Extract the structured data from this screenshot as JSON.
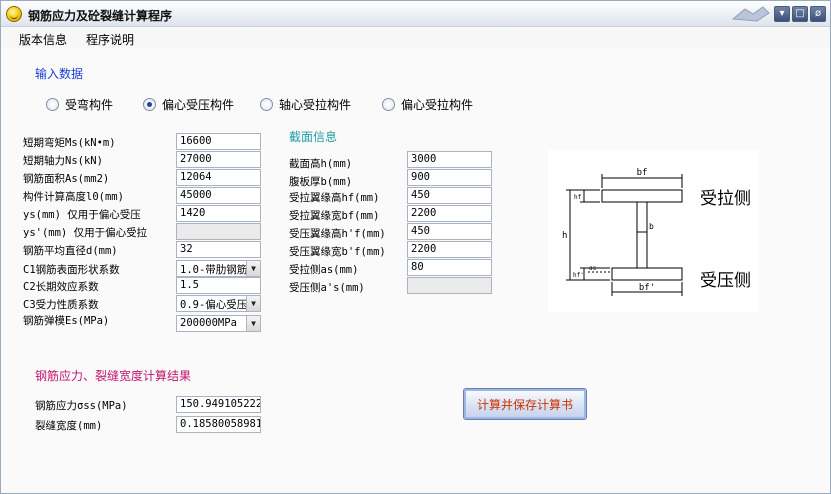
{
  "window": {
    "title": "钢筋应力及砼裂缝计算程序",
    "buttons": {
      "minimize": "▾",
      "maximize": "□",
      "close": "ø"
    }
  },
  "menu": [
    "版本信息",
    "程序说明"
  ],
  "input_section": {
    "title": "输入数据"
  },
  "member_types": [
    {
      "label": "受弯构件",
      "selected": false
    },
    {
      "label": "偏心受压构件",
      "selected": true
    },
    {
      "label": "轴心受拉构件",
      "selected": false
    },
    {
      "label": "偏心受拉构件",
      "selected": false
    }
  ],
  "left_params": [
    {
      "label": "短期弯矩Ms(kN•m)",
      "value": "16600"
    },
    {
      "label": "短期轴力Ns(kN)",
      "value": "27000"
    },
    {
      "label": "钢筋面积As(mm2)",
      "value": "12064"
    },
    {
      "label": "构件计算高度l0(mm)",
      "value": "45000"
    },
    {
      "label": "ys(mm) 仅用于偏心受压",
      "value": "1420"
    },
    {
      "label": "ys'(mm) 仅用于偏心受拉",
      "value": ""
    },
    {
      "label": "钢筋平均直径d(mm)",
      "value": "32"
    }
  ],
  "left_combos": [
    {
      "label": "C1钢筋表面形状系数",
      "value": "1.0-带肋钢筋"
    },
    {
      "label": "C2长期效应系数",
      "value": "1.5"
    },
    {
      "label": "C3受力性质系数",
      "value": "0.9-偏心受压"
    },
    {
      "label": "钢筋弹模Es(MPa)",
      "value": "200000MPa"
    }
  ],
  "section_info": {
    "title": "截面信息",
    "params": [
      {
        "label": "截面高h(mm)",
        "value": "3000"
      },
      {
        "label": "腹板厚b(mm)",
        "value": "900"
      },
      {
        "label": "受拉翼缘高hf(mm)",
        "value": "450"
      },
      {
        "label": "受拉翼缘宽bf(mm)",
        "value": "2200"
      },
      {
        "label": "受压翼缘高h'f(mm)",
        "value": "450"
      },
      {
        "label": "受压翼缘宽b'f(mm)",
        "value": "2200"
      },
      {
        "label": "受拉侧as(mm)",
        "value": "80"
      },
      {
        "label": "受压侧a's(mm)",
        "value": ""
      }
    ]
  },
  "diagram": {
    "top_label": "bf",
    "bottom_label": "bf'",
    "h_label": "h",
    "b_label": "b",
    "hf_label": "hf",
    "hf2_label": "hf'",
    "as_label": "as",
    "tension_side": "受拉侧",
    "compression_side": "受压侧"
  },
  "results": {
    "title": "钢筋应力、裂缝宽度计算结果",
    "stress_label": "钢筋应力σss(MPa)",
    "stress_value": "150.949105222",
    "crack_label": "裂缝宽度(mm)",
    "crack_value": "0.18580058981"
  },
  "calc_button": "计算并保存计算书"
}
